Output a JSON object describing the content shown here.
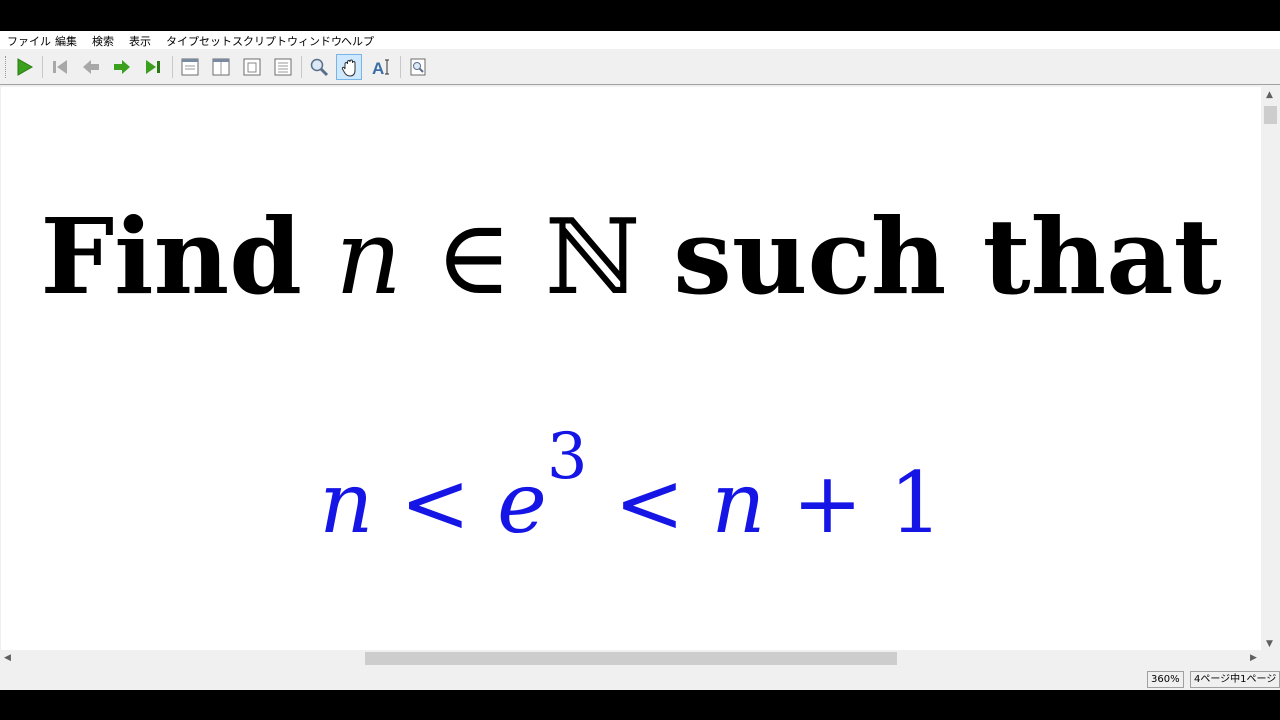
{
  "menu": [
    "ファイル",
    "編集",
    "検索",
    "表示",
    "タイプセット",
    "スクリプト",
    "ウィンドウ",
    "ヘルプ"
  ],
  "toolbar": {
    "buttons": [
      "play-icon",
      "first-page-icon",
      "prev-page-icon",
      "next-page-icon",
      "last-page-icon",
      "single-page-icon",
      "double-page-icon",
      "fit-page-icon",
      "continuous-icon",
      "zoom-icon",
      "hand-icon",
      "text-select-icon",
      "magnifier-icon"
    ],
    "active": "hand-icon",
    "accent_color": "#3aa01e"
  },
  "document": {
    "line1": {
      "find": "Find",
      "n": "n",
      "elem": "∈",
      "naturals": "ℕ",
      "such_that": "such that"
    },
    "line2": {
      "n1": "n",
      "lt1": "<",
      "e": "e",
      "exp": "3",
      "lt2": "<",
      "n2": "n",
      "plus": "+",
      "one": "1"
    },
    "equation_color": "#1515e6"
  },
  "status": {
    "zoom": "360%",
    "page_info": "4ページ中1ページ"
  }
}
